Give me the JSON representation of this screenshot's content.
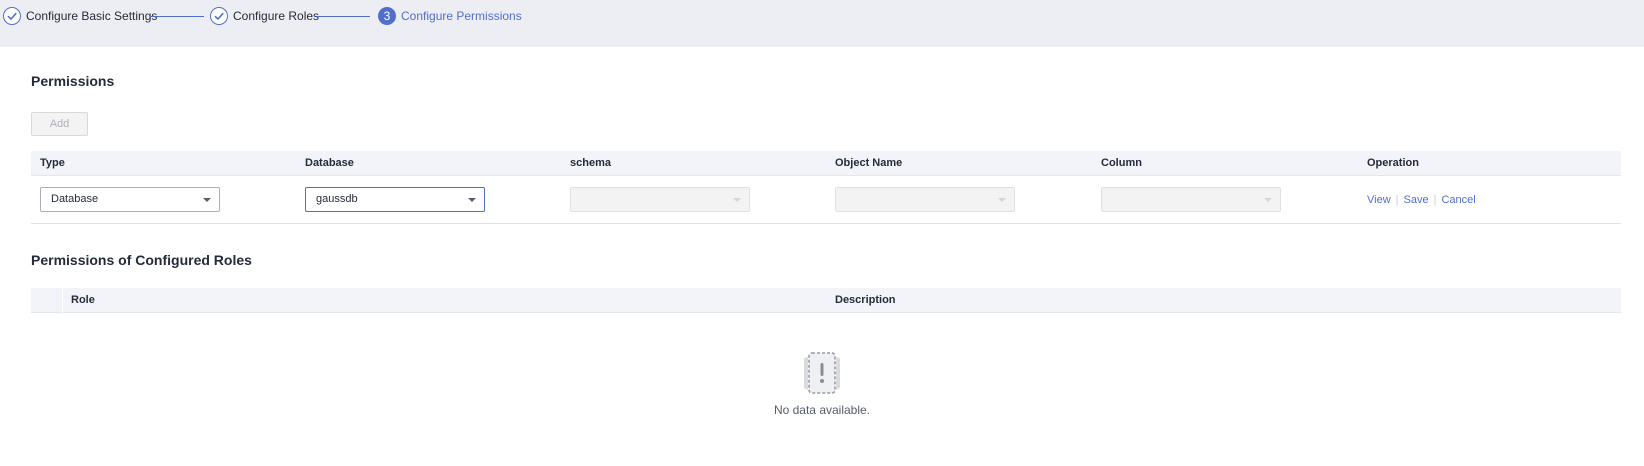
{
  "stepper": {
    "steps": [
      {
        "label": "Configure Basic Settings",
        "state": "done"
      },
      {
        "label": "Configure Roles",
        "state": "done"
      },
      {
        "label": "Configure Permissions",
        "state": "active",
        "number": "3"
      }
    ]
  },
  "permissions": {
    "title": "Permissions",
    "add_label": "Add",
    "columns": [
      "Type",
      "Database",
      "schema",
      "Object Name",
      "Column",
      "Operation"
    ],
    "row": {
      "type_value": "Database",
      "database_value": "gaussdb",
      "schema_value": "",
      "object_name_value": "",
      "column_value": "",
      "operations": {
        "view": "View",
        "save": "Save",
        "cancel": "Cancel"
      }
    }
  },
  "configured_roles": {
    "title": "Permissions of Configured Roles",
    "columns": [
      "Role",
      "Description"
    ],
    "empty_text": "No data available."
  },
  "colors": {
    "accent": "#526ecc",
    "stepper_bg": "#edeef3",
    "table_header_bg": "#f2f4fa"
  },
  "icons": {
    "step_done": "check-circle-icon",
    "empty": "empty-document-warning-icon",
    "dropdown": "caret-down-icon"
  }
}
